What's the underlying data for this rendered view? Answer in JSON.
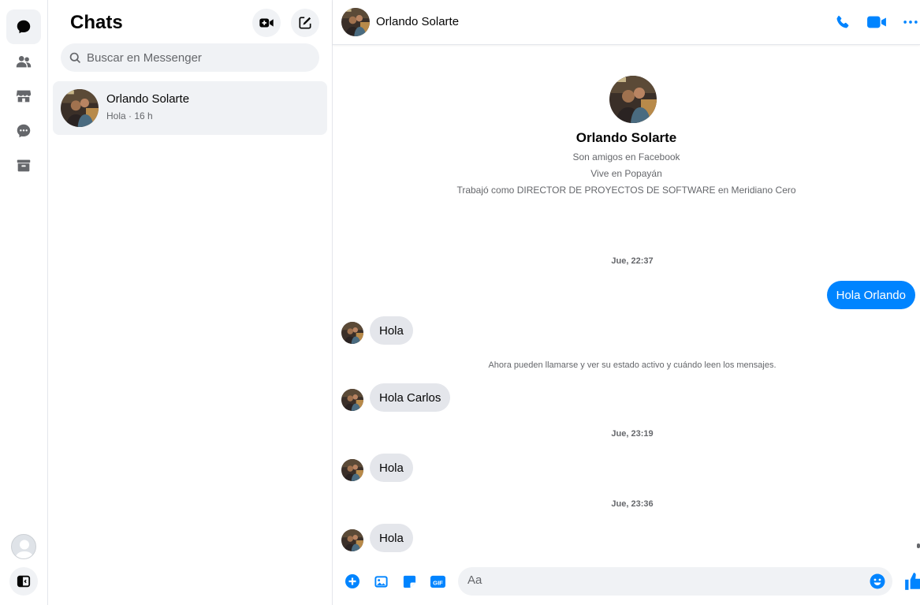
{
  "colors": {
    "accent": "#0084ff",
    "icon": "#050505",
    "muted": "#65676b",
    "bubble_in": "#e4e6eb",
    "panel": "#f0f2f5"
  },
  "rail": {
    "icons": [
      "chats-icon",
      "people-icon",
      "marketplace-icon",
      "requests-icon",
      "archive-icon"
    ],
    "bottom_icons": [
      "profile-avatar-icon",
      "toggle-sidebar-icon"
    ]
  },
  "list": {
    "title": "Chats",
    "buttons": [
      "new-video-room-icon",
      "new-message-icon"
    ],
    "search_placeholder": "Buscar en Messenger",
    "conversations": [
      {
        "name": "Orlando Solarte",
        "preview": "Hola · 16 h"
      }
    ]
  },
  "chat": {
    "header": {
      "name": "Orlando Solarte",
      "icons": [
        "phone-icon",
        "video-call-icon",
        "more-options-icon"
      ]
    },
    "profile": {
      "name": "Orlando Solarte",
      "lines": [
        "Son amigos en Facebook",
        "Vive en Popayán",
        "Trabajó como DIRECTOR DE PROYECTOS DE SOFTWARE en Meridiano Cero"
      ]
    },
    "timestamps": [
      "Jue, 22:37",
      "Jue, 23:19",
      "Jue, 23:36"
    ],
    "outgoing": [
      "Hola Orlando"
    ],
    "incoming": [
      "Hola",
      "Hola Carlos",
      "Hola",
      "Hola"
    ],
    "notice": "Ahora pueden llamarse y ver su estado activo y cuándo leen los mensajes.",
    "composer": {
      "placeholder": "Aa",
      "icons": [
        "add-icon",
        "image-icon",
        "sticker-icon",
        "gif-icon",
        "emoji-icon",
        "like-icon"
      ],
      "gif_label": "GIF"
    }
  }
}
